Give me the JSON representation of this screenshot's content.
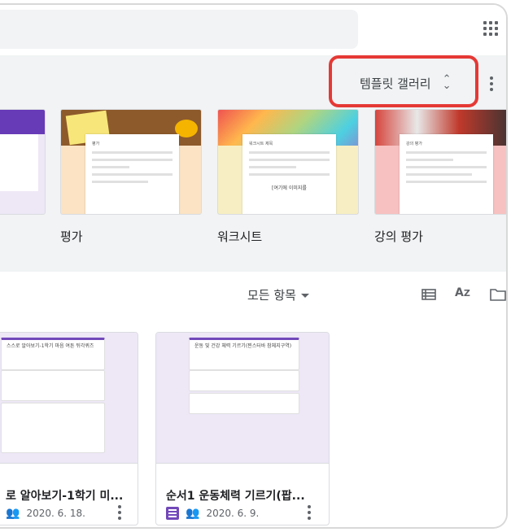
{
  "header": {
    "apps_icon": "apps-grid-icon"
  },
  "templates": {
    "gallery_label": "템플릿 갤러리",
    "highlight_color": "#e53935",
    "items": [
      {
        "name": "평가",
        "paper_title": "평가"
      },
      {
        "name": "워크시트",
        "paper_title": "워크시트 제목",
        "paper_caption": "[여기에 이미지를"
      },
      {
        "name": "강의 평가",
        "paper_title": "강의 평가"
      }
    ]
  },
  "recent": {
    "owner_filter": "모든 항목",
    "view_icons": [
      "list-view-icon",
      "sort-az-icon",
      "folder-icon"
    ],
    "docs": [
      {
        "title": "로 알아보기-1학기 미...",
        "date": "2020. 6. 18.",
        "preview_heading": "스스로 알아보기-1학기 마음 여튼 뒤각퀴즈"
      },
      {
        "title": "순서1 운동체력 기르기(팝...",
        "date": "2020. 6. 9.",
        "preview_heading": "운동 및 건강 체력 기르기(찐스터바 참체지구역)"
      }
    ]
  },
  "colors": {
    "forms_purple": "#7248b9",
    "panel_bg": "#f1f3f4"
  }
}
